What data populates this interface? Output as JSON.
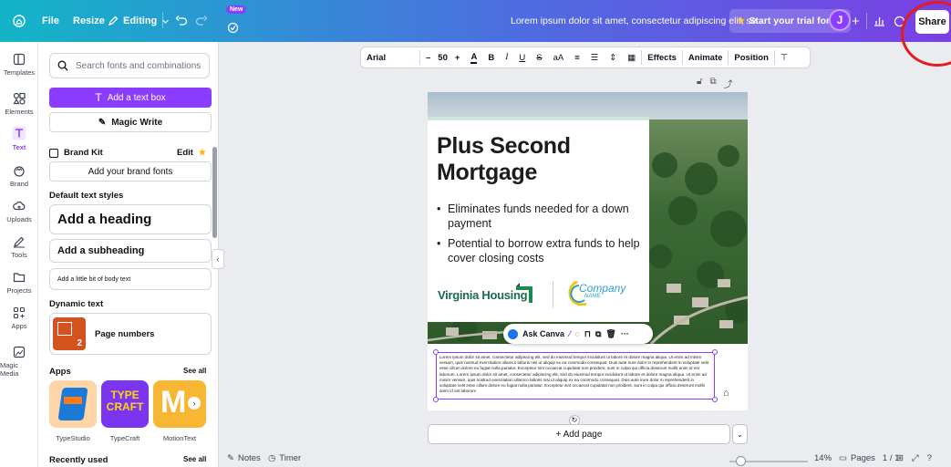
{
  "topbar": {
    "file_label": "File",
    "resize_label": "Resize",
    "editing_label": "Editing",
    "new_badge": "New",
    "doc_title": "Lorem ipsum dolor sit amet, consectetur adipiscing elit, se...",
    "trial_label": "Start your trial for $0",
    "avatar_initial": "J",
    "share_label": "Share",
    "accent_color": "#8b3dff",
    "annotation_ring_color": "#e31c1c"
  },
  "rail": {
    "items": [
      {
        "label": "Templates",
        "icon": "layout-icon"
      },
      {
        "label": "Elements",
        "icon": "shapes-icon"
      },
      {
        "label": "Text",
        "icon": "text-icon"
      },
      {
        "label": "Brand",
        "icon": "crown-icon"
      },
      {
        "label": "Uploads",
        "icon": "cloud-upload-icon"
      },
      {
        "label": "Tools",
        "icon": "pen-icon"
      },
      {
        "label": "Projects",
        "icon": "folder-icon"
      },
      {
        "label": "Apps",
        "icon": "apps-icon"
      },
      {
        "label": "Magic Media",
        "icon": "magic-media-icon"
      }
    ]
  },
  "panel": {
    "search_placeholder": "Search fonts and combinations",
    "add_text_box": "Add a text box",
    "magic_write": "Magic Write",
    "brand_kit": "Brand Kit",
    "edit": "Edit",
    "add_brand_fonts": "Add your brand fonts",
    "default_styles": "Default text styles",
    "add_heading": "Add a heading",
    "add_subheading": "Add a subheading",
    "add_body": "Add a little bit of body text",
    "dynamic_text": "Dynamic text",
    "page_numbers": "Page numbers",
    "page_numbers_thumb": "2",
    "apps": "Apps",
    "see_all": "See all",
    "app_names": [
      "TypeStudio",
      "TypeCraft",
      "MotionText"
    ],
    "typecraft_thumb": "TYPE CRAFT",
    "recently_used": "Recently used",
    "see_all_2": "See all"
  },
  "format_toolbar": {
    "font": "Arial",
    "size_minus": "–",
    "size": "50",
    "size_plus": "+",
    "aa": "aA",
    "effects": "Effects",
    "animate": "Animate",
    "position": "Position"
  },
  "page": {
    "headline_line1": "Plus Second",
    "headline_line2": "Mortgage",
    "bullets": [
      "Eliminates funds needed for a down payment",
      "Potential to borrow extra funds to help cover closing costs"
    ],
    "logo_left": "Virginia Housing",
    "logo_right": "Company",
    "logo_right_sub": "NAME",
    "ask_canva": "Ask Canva",
    "lorem": "Lorem ipsum dolor sit amet, consectetur adipiscing elit, sed do eiusmod tempor incididunt ut labore et dolore magna aliqua. Ut enim ad minim veniam, quis nostrud exercitation ullamco laboris nisi ut aliquip ex ea commodo consequat. Duis aute irure dolor in reprehenderit in voluptate velit esse cillum dolore eu fugiat nulla pariatur. Excepteur sint occaecat cupidatat non proident, sunt in culpa qui officia deserunt mollit anim id est laborum. Lorem ipsum dolor sit amet, consectetur adipiscing elit, sed do eiusmod tempor incididunt ut labore et dolore magna aliqua. Ut enim ad minim veniam, quis nostrud exercitation ullamco laboris nisi ut aliquip ex ea commodo consequat. Duis aute irure dolor in reprehenderit in voluptate velit esse cillum dolore eu fugiat nulla pariatur. Excepteur sint occaecat cupidatat non proident, sunt in culpa qui officia deserunt mollit anim id est laborum",
    "add_page": "+ Add page"
  },
  "bottom": {
    "notes": "Notes",
    "timer": "Timer",
    "zoom": "14%",
    "zoom_fraction": 0.14,
    "pages_label": "Pages",
    "pages_value": "1 / 1"
  }
}
